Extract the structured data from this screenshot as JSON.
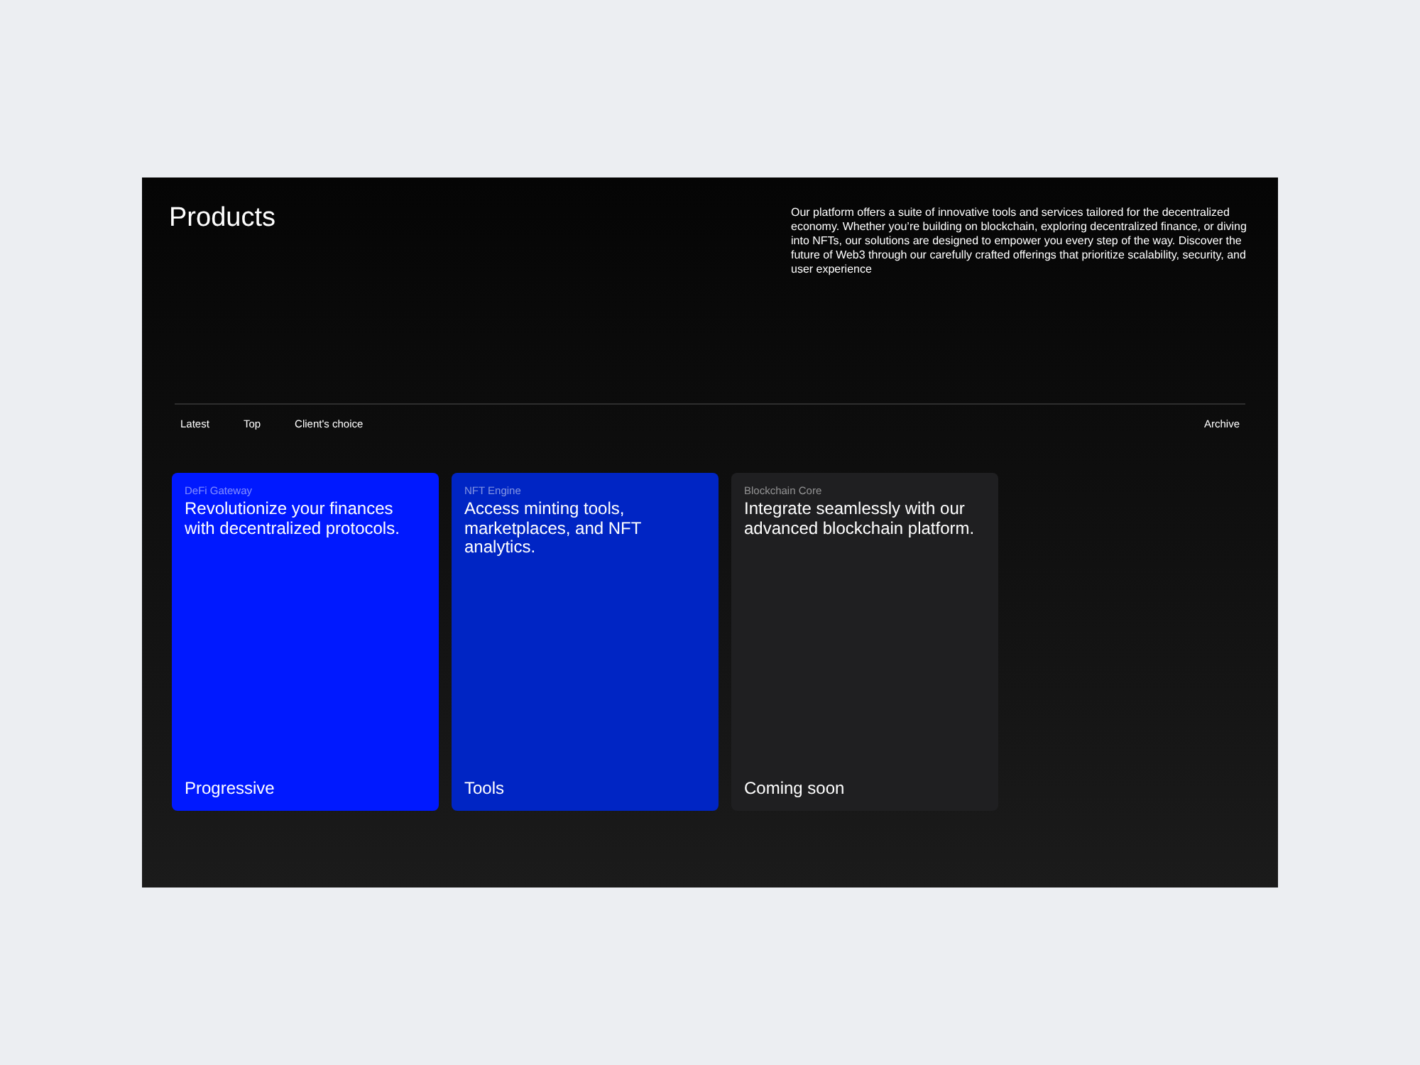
{
  "title": "Products",
  "description": "Our platform offers a suite of innovative tools and services tailored for the decentralized economy. Whether you’re building on blockchain, exploring decentralized finance, or diving into NFTs, our solutions are designed to empower you every step of the way. Discover the future of Web3 through our carefully crafted offerings that prioritize scalability, security, and user experience",
  "filters": [
    "Latest",
    "Top",
    "Client's choice"
  ],
  "archive_link": "Archive",
  "cards": [
    {
      "label": "DeFi Gateway",
      "text": "Revolutionize your finances with decentralized protocols.",
      "footer": "Progressive",
      "color": "#0019ff"
    },
    {
      "label": "NFT Engine",
      "text": "Access minting tools, marketplaces, and NFT analytics.",
      "footer": "Tools",
      "color": "#0025c4"
    },
    {
      "label": "Blockchain Core",
      "text": "Integrate seamlessly with our advanced blockchain platform.",
      "footer": "Coming soon",
      "color": "#1f1f21"
    }
  ]
}
